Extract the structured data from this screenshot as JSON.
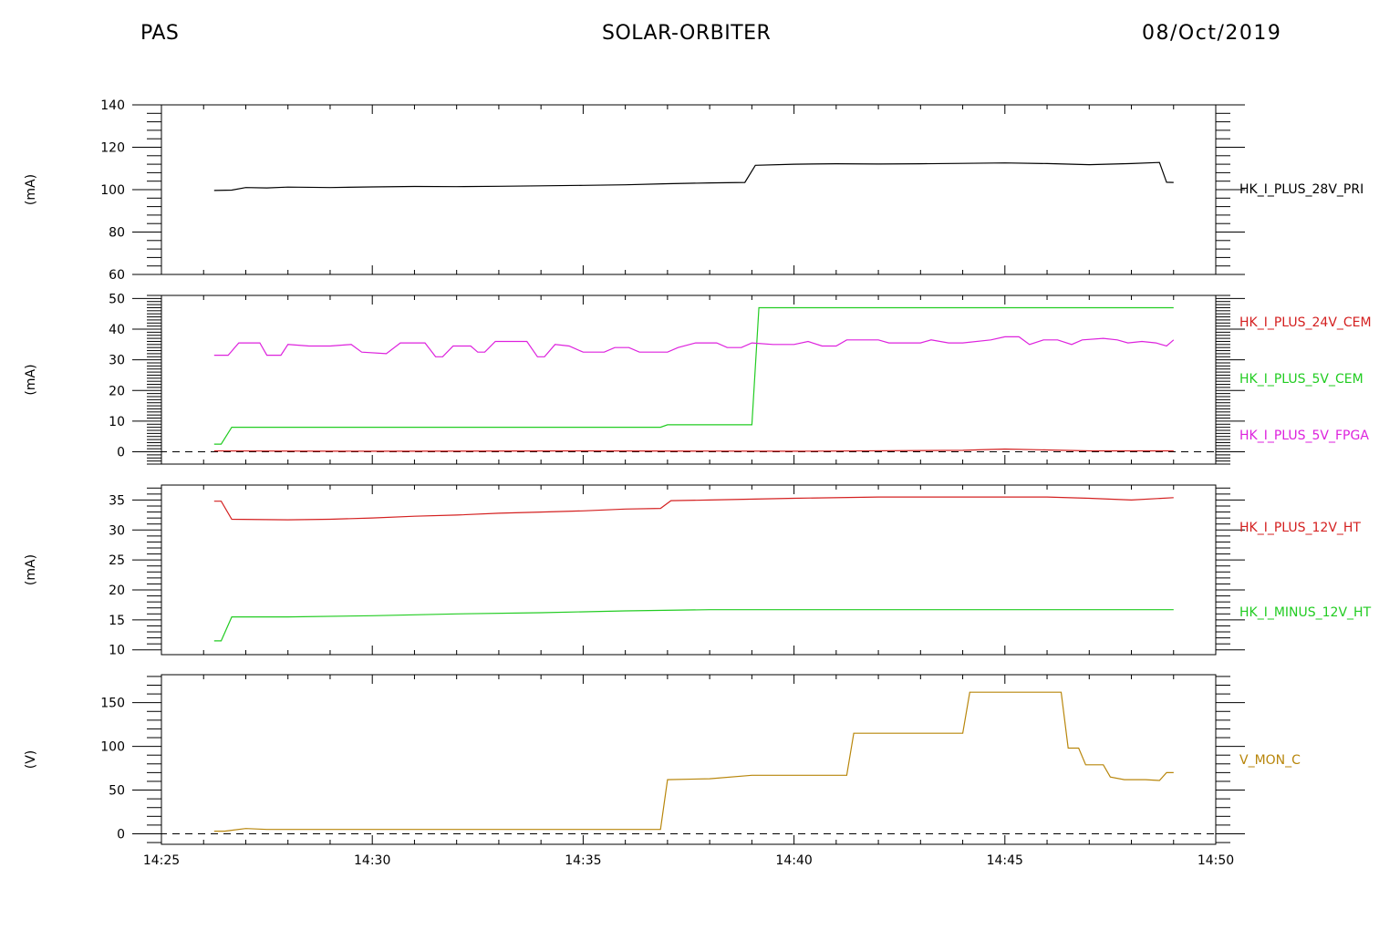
{
  "header": {
    "left": "PAS",
    "center": "SOLAR-ORBITER",
    "right": "08/Oct/2019"
  },
  "chart_data": [
    {
      "type": "line",
      "ylabel": "(mA)",
      "ylim": [
        60,
        140
      ],
      "yticks": [
        60,
        80,
        100,
        120,
        140
      ],
      "xlim": [
        "14:25",
        "14:50"
      ],
      "series": [
        {
          "name": "HK_I_PLUS_28V_PRI",
          "color": "#000000",
          "points": [
            [
              "14:26:15",
              99.6
            ],
            [
              "14:26:40",
              99.8
            ],
            [
              "14:27:00",
              101.0
            ],
            [
              "14:27:30",
              100.8
            ],
            [
              "14:28:00",
              101.2
            ],
            [
              "14:29:00",
              101.0
            ],
            [
              "14:30:00",
              101.3
            ],
            [
              "14:31:00",
              101.5
            ],
            [
              "14:32:00",
              101.4
            ],
            [
              "14:33:00",
              101.6
            ],
            [
              "14:34:00",
              101.8
            ],
            [
              "14:35:00",
              102.0
            ],
            [
              "14:36:00",
              102.3
            ],
            [
              "14:37:00",
              102.8
            ],
            [
              "14:38:00",
              103.2
            ],
            [
              "14:38:50",
              103.4
            ],
            [
              "14:39:05",
              111.5
            ],
            [
              "14:40:00",
              112.0
            ],
            [
              "14:41:00",
              112.2
            ],
            [
              "14:42:00",
              112.1
            ],
            [
              "14:43:00",
              112.2
            ],
            [
              "14:44:00",
              112.4
            ],
            [
              "14:45:00",
              112.6
            ],
            [
              "14:46:00",
              112.3
            ],
            [
              "14:47:00",
              111.8
            ],
            [
              "14:48:00",
              112.3
            ],
            [
              "14:48:40",
              112.8
            ],
            [
              "14:48:50",
              103.5
            ],
            [
              "14:49:00",
              103.4
            ]
          ]
        }
      ]
    },
    {
      "type": "line",
      "ylabel": "(mA)",
      "ylim": [
        -4,
        51
      ],
      "yticks": [
        0,
        10,
        20,
        30,
        40,
        50
      ],
      "xlim": [
        "14:25",
        "14:50"
      ],
      "series": [
        {
          "name": "HK_I_PLUS_24V_CEM",
          "color": "#d42020",
          "points": [
            [
              "14:26:15",
              0.3
            ],
            [
              "14:30:00",
              0.2
            ],
            [
              "14:35:00",
              0.3
            ],
            [
              "14:40:00",
              0.2
            ],
            [
              "14:44:00",
              0.5
            ],
            [
              "14:45:00",
              0.9
            ],
            [
              "14:46:00",
              0.6
            ],
            [
              "14:47:00",
              0.3
            ],
            [
              "14:49:00",
              0.3
            ]
          ]
        },
        {
          "name": "HK_I_PLUS_5V_CEM",
          "color": "#22cc22",
          "points": [
            [
              "14:26:15",
              2.5
            ],
            [
              "14:26:25",
              2.5
            ],
            [
              "14:26:40",
              8.0
            ],
            [
              "14:36:50",
              8.0
            ],
            [
              "14:37:00",
              8.8
            ],
            [
              "14:39:00",
              8.8
            ],
            [
              "14:39:10",
              47.0
            ],
            [
              "14:49:00",
              47.0
            ]
          ]
        },
        {
          "name": "HK_I_PLUS_5V_FPGA",
          "color": "#dd22dd",
          "points": [
            [
              "14:26:15",
              31.5
            ],
            [
              "14:26:35",
              31.5
            ],
            [
              "14:26:50",
              35.5
            ],
            [
              "14:27:20",
              35.5
            ],
            [
              "14:27:30",
              31.5
            ],
            [
              "14:27:50",
              31.5
            ],
            [
              "14:28:00",
              35.0
            ],
            [
              "14:28:30",
              34.5
            ],
            [
              "14:29:00",
              34.5
            ],
            [
              "14:29:30",
              35.0
            ],
            [
              "14:29:45",
              32.5
            ],
            [
              "14:30:20",
              32.0
            ],
            [
              "14:30:40",
              35.5
            ],
            [
              "14:31:15",
              35.5
            ],
            [
              "14:31:30",
              31.0
            ],
            [
              "14:31:40",
              31.0
            ],
            [
              "14:31:55",
              34.5
            ],
            [
              "14:32:20",
              34.5
            ],
            [
              "14:32:30",
              32.5
            ],
            [
              "14:32:40",
              32.5
            ],
            [
              "14:32:55",
              36.0
            ],
            [
              "14:33:40",
              36.0
            ],
            [
              "14:33:55",
              31.0
            ],
            [
              "14:34:05",
              31.0
            ],
            [
              "14:34:20",
              35.0
            ],
            [
              "14:34:40",
              34.5
            ],
            [
              "14:35:00",
              32.5
            ],
            [
              "14:35:30",
              32.5
            ],
            [
              "14:35:45",
              34.0
            ],
            [
              "14:36:05",
              34.0
            ],
            [
              "14:36:20",
              32.5
            ],
            [
              "14:37:00",
              32.5
            ],
            [
              "14:37:15",
              34.0
            ],
            [
              "14:37:40",
              35.5
            ],
            [
              "14:38:10",
              35.5
            ],
            [
              "14:38:25",
              34.0
            ],
            [
              "14:38:45",
              34.0
            ],
            [
              "14:39:00",
              35.5
            ],
            [
              "14:39:30",
              35.0
            ],
            [
              "14:40:00",
              35.0
            ],
            [
              "14:40:20",
              36.0
            ],
            [
              "14:40:40",
              34.5
            ],
            [
              "14:41:00",
              34.5
            ],
            [
              "14:41:15",
              36.5
            ],
            [
              "14:42:00",
              36.5
            ],
            [
              "14:42:15",
              35.5
            ],
            [
              "14:43:00",
              35.5
            ],
            [
              "14:43:15",
              36.5
            ],
            [
              "14:43:40",
              35.5
            ],
            [
              "14:44:00",
              35.5
            ],
            [
              "14:44:40",
              36.5
            ],
            [
              "14:45:00",
              37.5
            ],
            [
              "14:45:20",
              37.5
            ],
            [
              "14:45:35",
              35.0
            ],
            [
              "14:45:55",
              36.5
            ],
            [
              "14:46:15",
              36.5
            ],
            [
              "14:46:35",
              35.0
            ],
            [
              "14:46:50",
              36.5
            ],
            [
              "14:47:20",
              37.0
            ],
            [
              "14:47:40",
              36.5
            ],
            [
              "14:47:55",
              35.5
            ],
            [
              "14:48:15",
              36.0
            ],
            [
              "14:48:35",
              35.5
            ],
            [
              "14:48:50",
              34.5
            ],
            [
              "14:49:00",
              36.5
            ]
          ]
        }
      ]
    },
    {
      "type": "line",
      "ylabel": "(mA)",
      "ylim": [
        9.2,
        37.5
      ],
      "yticks": [
        10,
        15,
        20,
        25,
        30,
        35
      ],
      "xlim": [
        "14:25",
        "14:50"
      ],
      "series": [
        {
          "name": "HK_I_PLUS_12V_HT",
          "color": "#d42020",
          "points": [
            [
              "14:26:15",
              34.8
            ],
            [
              "14:26:25",
              34.8
            ],
            [
              "14:26:40",
              31.8
            ],
            [
              "14:28:00",
              31.7
            ],
            [
              "14:29:00",
              31.8
            ],
            [
              "14:30:00",
              32.0
            ],
            [
              "14:31:00",
              32.3
            ],
            [
              "14:32:00",
              32.5
            ],
            [
              "14:33:00",
              32.8
            ],
            [
              "14:34:00",
              33.0
            ],
            [
              "14:35:00",
              33.2
            ],
            [
              "14:36:00",
              33.5
            ],
            [
              "14:36:50",
              33.6
            ],
            [
              "14:37:05",
              34.9
            ],
            [
              "14:38:00",
              35.0
            ],
            [
              "14:40:00",
              35.3
            ],
            [
              "14:42:00",
              35.5
            ],
            [
              "14:44:00",
              35.5
            ],
            [
              "14:46:00",
              35.5
            ],
            [
              "14:47:00",
              35.3
            ],
            [
              "14:48:00",
              35.0
            ],
            [
              "14:49:00",
              35.4
            ]
          ]
        },
        {
          "name": "HK_I_MINUS_12V_HT",
          "color": "#22cc22",
          "points": [
            [
              "14:26:15",
              11.5
            ],
            [
              "14:26:25",
              11.5
            ],
            [
              "14:26:40",
              15.5
            ],
            [
              "14:28:00",
              15.5
            ],
            [
              "14:30:00",
              15.7
            ],
            [
              "14:32:00",
              16.0
            ],
            [
              "14:34:00",
              16.2
            ],
            [
              "14:36:00",
              16.5
            ],
            [
              "14:38:00",
              16.7
            ],
            [
              "14:40:00",
              16.7
            ],
            [
              "14:44:00",
              16.7
            ],
            [
              "14:49:00",
              16.7
            ]
          ]
        }
      ]
    },
    {
      "type": "line",
      "ylabel": "(V)",
      "ylim": [
        -12,
        182
      ],
      "yticks": [
        0,
        50,
        100,
        150
      ],
      "xlim": [
        "14:25",
        "14:50"
      ],
      "series": [
        {
          "name": "V_MON_C",
          "color": "#b8860b",
          "points": [
            [
              "14:26:15",
              3.0
            ],
            [
              "14:26:30",
              3.0
            ],
            [
              "14:27:00",
              6.0
            ],
            [
              "14:27:30",
              5.0
            ],
            [
              "14:30:00",
              5.0
            ],
            [
              "14:32:00",
              5.0
            ],
            [
              "14:34:00",
              5.0
            ],
            [
              "14:36:00",
              5.0
            ],
            [
              "14:36:50",
              5.0
            ],
            [
              "14:37:00",
              62.0
            ],
            [
              "14:38:00",
              63.0
            ],
            [
              "14:39:00",
              67.0
            ],
            [
              "14:40:00",
              67.0
            ],
            [
              "14:41:15",
              67.0
            ],
            [
              "14:41:25",
              115.0
            ],
            [
              "14:44:00",
              115.0
            ],
            [
              "14:44:10",
              162.0
            ],
            [
              "14:46:20",
              162.0
            ],
            [
              "14:46:30",
              98.0
            ],
            [
              "14:46:45",
              98.0
            ],
            [
              "14:46:55",
              79.0
            ],
            [
              "14:47:20",
              79.0
            ],
            [
              "14:47:30",
              65.0
            ],
            [
              "14:47:50",
              62.0
            ],
            [
              "14:48:20",
              62.0
            ],
            [
              "14:48:40",
              61.0
            ],
            [
              "14:48:50",
              70.0
            ],
            [
              "14:49:00",
              70.0
            ]
          ]
        }
      ]
    }
  ],
  "xticks": [
    "14:25",
    "14:30",
    "14:35",
    "14:40",
    "14:45",
    "14:50"
  ]
}
